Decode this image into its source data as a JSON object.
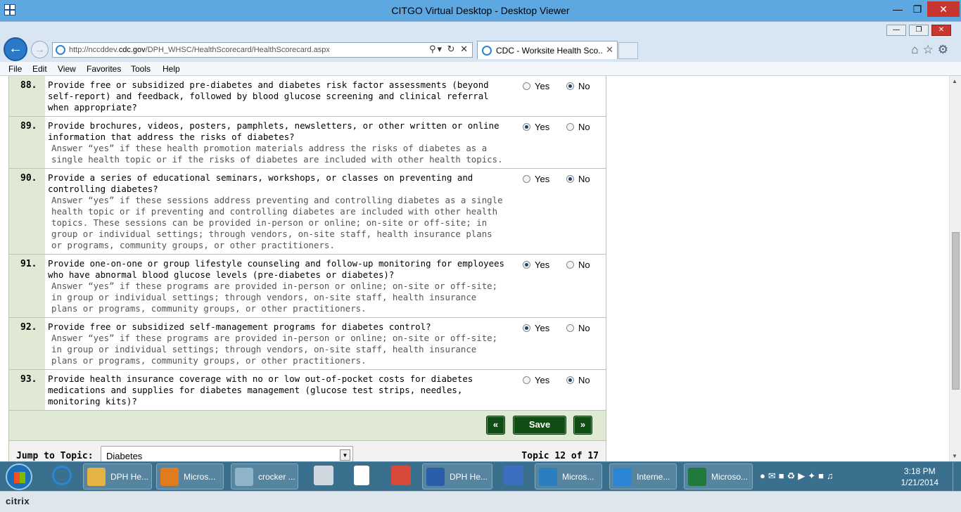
{
  "outer_window": {
    "title": "CITGO Virtual Desktop - Desktop Viewer"
  },
  "browser": {
    "url_prefix": "http://nccddev.",
    "url_domain": "cdc.gov",
    "url_path": "/DPH_WHSC/HealthScorecard/HealthScorecard.aspx",
    "tab_title": "CDC - Worksite Health Sco..."
  },
  "menu": [
    "File",
    "Edit",
    "View",
    "Favorites",
    "Tools",
    "Help"
  ],
  "options": {
    "yes": "Yes",
    "no": "No"
  },
  "questions": [
    {
      "num": "88.",
      "text": "Provide free or subsidized pre-diabetes and diabetes risk factor assessments (beyond self-report) and feedback, followed by blood glucose screening and clinical referral when appropriate?",
      "hint": "",
      "answer": "no"
    },
    {
      "num": "89.",
      "text": "Provide brochures, videos, posters, pamphlets, newsletters, or other written or online information that address the risks of diabetes?",
      "hint": "Answer “yes” if these health promotion materials address the risks of diabetes as a single health topic or if the risks of diabetes are included with other health topics.",
      "answer": "yes"
    },
    {
      "num": "90.",
      "text": "Provide a series of educational seminars, workshops, or classes on preventing and controlling diabetes?",
      "hint": "Answer “yes” if these sessions address preventing and controlling diabetes as a single health topic or if preventing and controlling diabetes are included with other health topics. These sessions can be provided in-person or online; on-site or off-site; in group or individual settings; through vendors, on-site staff, health insurance plans or programs, community groups, or other practitioners.",
      "answer": "no"
    },
    {
      "num": "91.",
      "text": "Provide one-on-one or group lifestyle counseling and follow-up monitoring for employees who have abnormal blood glucose levels (pre-diabetes or diabetes)?",
      "hint": "Answer “yes” if these programs are provided in-person or online; on-site or off-site; in group or individual settings; through vendors, on-site staff, health insurance plans or programs, community groups, or other practitioners.",
      "answer": "yes"
    },
    {
      "num": "92.",
      "text": "Provide free or subsidized self-management programs for diabetes control?",
      "hint": "Answer “yes” if these programs are provided in-person or online; on-site or off-site; in group or individual settings; through vendors, on-site staff, health insurance plans or programs, community groups, or other practitioners.",
      "answer": "yes"
    },
    {
      "num": "93.",
      "text": "Provide health insurance coverage with no or low out-of-pocket costs for diabetes medications and supplies for diabetes management (glucose test strips, needles, monitoring kits)?",
      "hint": "",
      "answer": "no"
    }
  ],
  "nav": {
    "prev": "«",
    "save": "Save",
    "next": "»"
  },
  "jump": {
    "label": "Jump to Topic:",
    "selected": "Diabetes",
    "topic_status": "Topic 12 of 17"
  },
  "taskbar": {
    "items": [
      {
        "label": "DPH He...",
        "color": "#e3b443"
      },
      {
        "label": "Micros...",
        "color": "#e07b1e"
      },
      {
        "label": "crocker ...",
        "color": "#8fb4c8"
      },
      {
        "label": "DPH He...",
        "color": "#2b5eaa"
      },
      {
        "label": "Micros...",
        "color": "#2b7fbf"
      },
      {
        "label": "Interne...",
        "color": "#2b86d6"
      },
      {
        "label": "Microso...",
        "color": "#217a3b"
      }
    ],
    "time": "3:18 PM",
    "date": "1/21/2014"
  },
  "citrix": {
    "brand": "citrix"
  }
}
